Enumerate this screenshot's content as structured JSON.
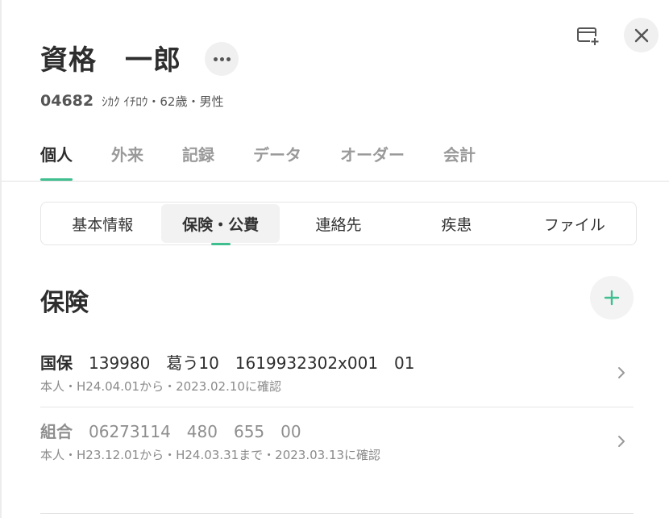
{
  "patient": {
    "name": "資格　一郎",
    "id": "04682",
    "details": "ｼｶｸ ｲﾁﾛｳ・62歳・男性"
  },
  "header_icons": {
    "more": "more-horizontal-icon",
    "card": "card-add-icon",
    "close": "close-icon"
  },
  "main_tabs": [
    {
      "label": "個人",
      "active": true
    },
    {
      "label": "外来"
    },
    {
      "label": "記録"
    },
    {
      "label": "データ"
    },
    {
      "label": "オーダー"
    },
    {
      "label": "会計"
    }
  ],
  "sub_tabs": [
    {
      "label": "基本情報"
    },
    {
      "label": "保険・公費",
      "active": true
    },
    {
      "label": "連絡先"
    },
    {
      "label": "疾患"
    },
    {
      "label": "ファイル"
    }
  ],
  "section": {
    "title": "保険",
    "add_icon": "plus-icon"
  },
  "insurances": [
    {
      "type": "国保",
      "numbers": "139980　葛う10　1619932302x001　01",
      "detail": "本人・H24.04.01から・2023.02.10に確認"
    },
    {
      "type": "組合",
      "numbers": "06273114　480　655　00",
      "detail": "本人・H23.12.01から・H24.03.31まで・2023.03.13に確認"
    }
  ],
  "colors": {
    "accent": "#3fbf8f",
    "text": "#2e2e2e",
    "muted": "#8a8a8a",
    "bubble": "#f0f0f0"
  }
}
